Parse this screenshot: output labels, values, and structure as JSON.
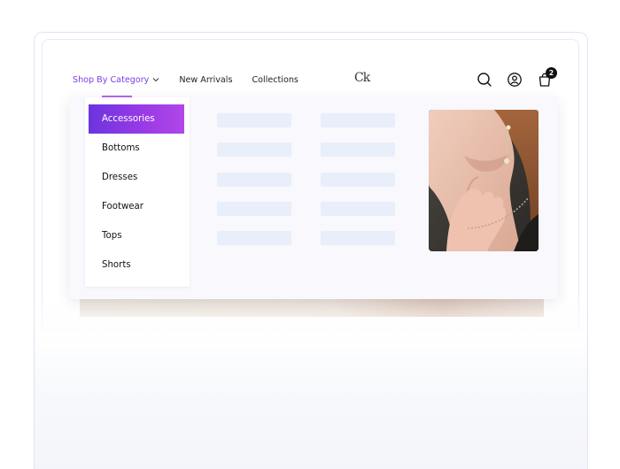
{
  "nav": {
    "items": [
      {
        "label": "Shop By Category",
        "active": true
      },
      {
        "label": "New Arrivals"
      },
      {
        "label": "Collections"
      }
    ]
  },
  "logo": {
    "text": "Ck"
  },
  "header_icons": {
    "search": "search-icon",
    "account": "user-icon",
    "cart": "shopping-bag-icon",
    "cart_count": "2"
  },
  "categories": [
    {
      "label": "Accessories",
      "selected": true
    },
    {
      "label": "Bottoms"
    },
    {
      "label": "Dresses"
    },
    {
      "label": "Footwear"
    },
    {
      "label": "Tops"
    },
    {
      "label": "Shorts"
    }
  ],
  "colors": {
    "accent": "#7b3fe4",
    "selected_gradient_start": "#6c34e0",
    "selected_gradient_end": "#b047e8",
    "skeleton": "#e9eefb"
  }
}
